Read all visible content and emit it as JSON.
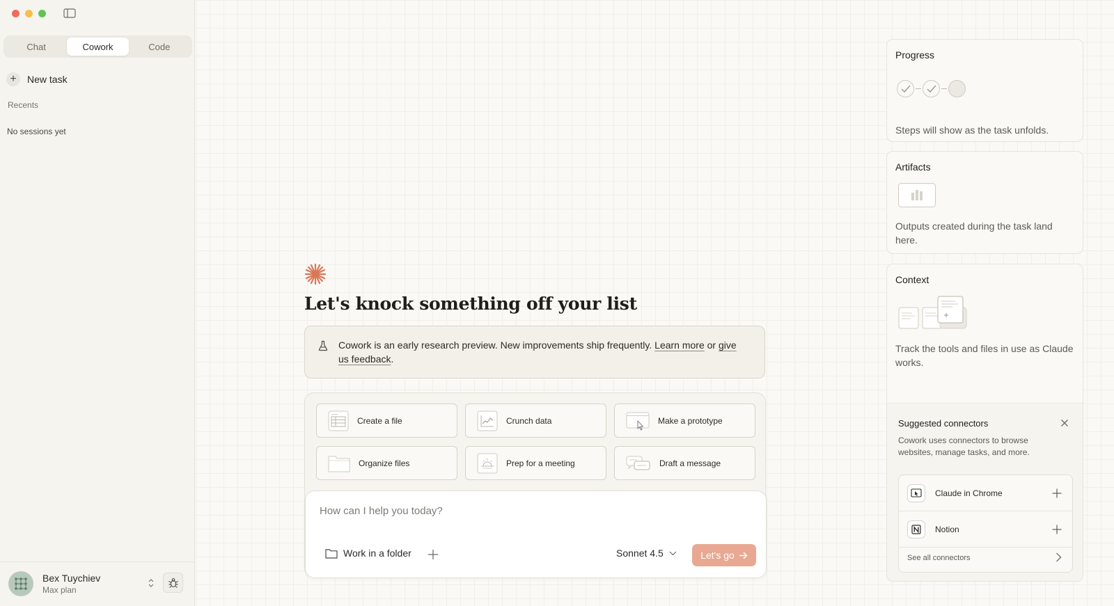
{
  "sidebar": {
    "tabs": [
      {
        "label": "Chat"
      },
      {
        "label": "Cowork"
      },
      {
        "label": "Code"
      }
    ],
    "active_tab": "Cowork",
    "new_task_label": "New task",
    "recents_label": "Recents",
    "empty_sessions": "No sessions yet",
    "user": {
      "name": "Bex Tuychiev",
      "plan": "Max plan"
    }
  },
  "main": {
    "headline": "Let's knock something off your list",
    "notice": {
      "text_before": "Cowork is an early research preview. New improvements ship frequently. ",
      "learn_more": "Learn more",
      "text_middle": " or ",
      "feedback": "give us feedback",
      "text_after": "."
    },
    "quick_actions": [
      {
        "label": "Create a file",
        "icon": "spreadsheet-icon"
      },
      {
        "label": "Crunch data",
        "icon": "chart-icon"
      },
      {
        "label": "Make a prototype",
        "icon": "browser-cursor-icon"
      },
      {
        "label": "Organize files",
        "icon": "folder-icon"
      },
      {
        "label": "Prep for a meeting",
        "icon": "sunrise-icon"
      },
      {
        "label": "Draft a message",
        "icon": "chat-bubbles-icon"
      }
    ],
    "composer": {
      "placeholder": "How can I help you today?",
      "folder_label": "Work in a folder",
      "model": "Sonnet 4.5",
      "submit_label": "Let's go"
    }
  },
  "right_panel": {
    "progress": {
      "title": "Progress",
      "description": "Steps will show as the task unfolds."
    },
    "artifacts": {
      "title": "Artifacts",
      "description": "Outputs created during the task land here."
    },
    "context": {
      "title": "Context",
      "description": "Track the tools and files in use as Claude works."
    },
    "connectors": {
      "title": "Suggested connectors",
      "description": "Cowork uses connectors to browse websites, manage tasks, and more.",
      "items": [
        {
          "name": "Claude in Chrome",
          "icon": "chrome-cursor-icon"
        },
        {
          "name": "Notion",
          "icon": "notion-icon"
        }
      ],
      "see_all": "See all connectors"
    }
  },
  "colors": {
    "accent": "#d97757",
    "submit_button": "#e8a891",
    "background": "#faf9f5",
    "sidebar_bg": "#f5f4ef"
  }
}
